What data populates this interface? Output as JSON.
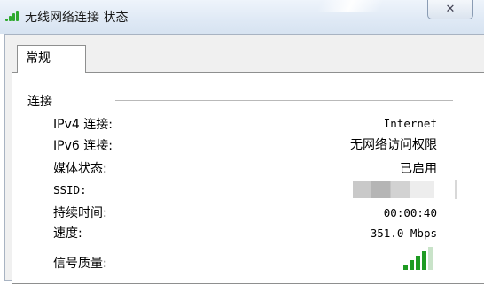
{
  "window": {
    "title": "无线网络连接 状态",
    "close_glyph": "✕",
    "accent_color": "#2fa92f"
  },
  "tabs": [
    {
      "label": "常规",
      "selected": true
    }
  ],
  "connection": {
    "section_label": "连接",
    "rows": [
      {
        "label": "IPv4 连接:",
        "value": "Internet"
      },
      {
        "label": "IPv6 连接:",
        "value": "无网络访问权限"
      },
      {
        "label": "媒体状态:",
        "value": "已启用"
      },
      {
        "label": "SSID:",
        "value": ""
      },
      {
        "label": "持续时间:",
        "value": "00:00:40"
      },
      {
        "label": "速度:",
        "value": "351.0 Mbps"
      },
      {
        "label": "信号质量:",
        "value": ""
      }
    ],
    "signal_quality_level": 0.8
  },
  "icons": {
    "title_icon": "wifi-signal-icon",
    "signal_quality_icon": "signal-strength-icon"
  }
}
